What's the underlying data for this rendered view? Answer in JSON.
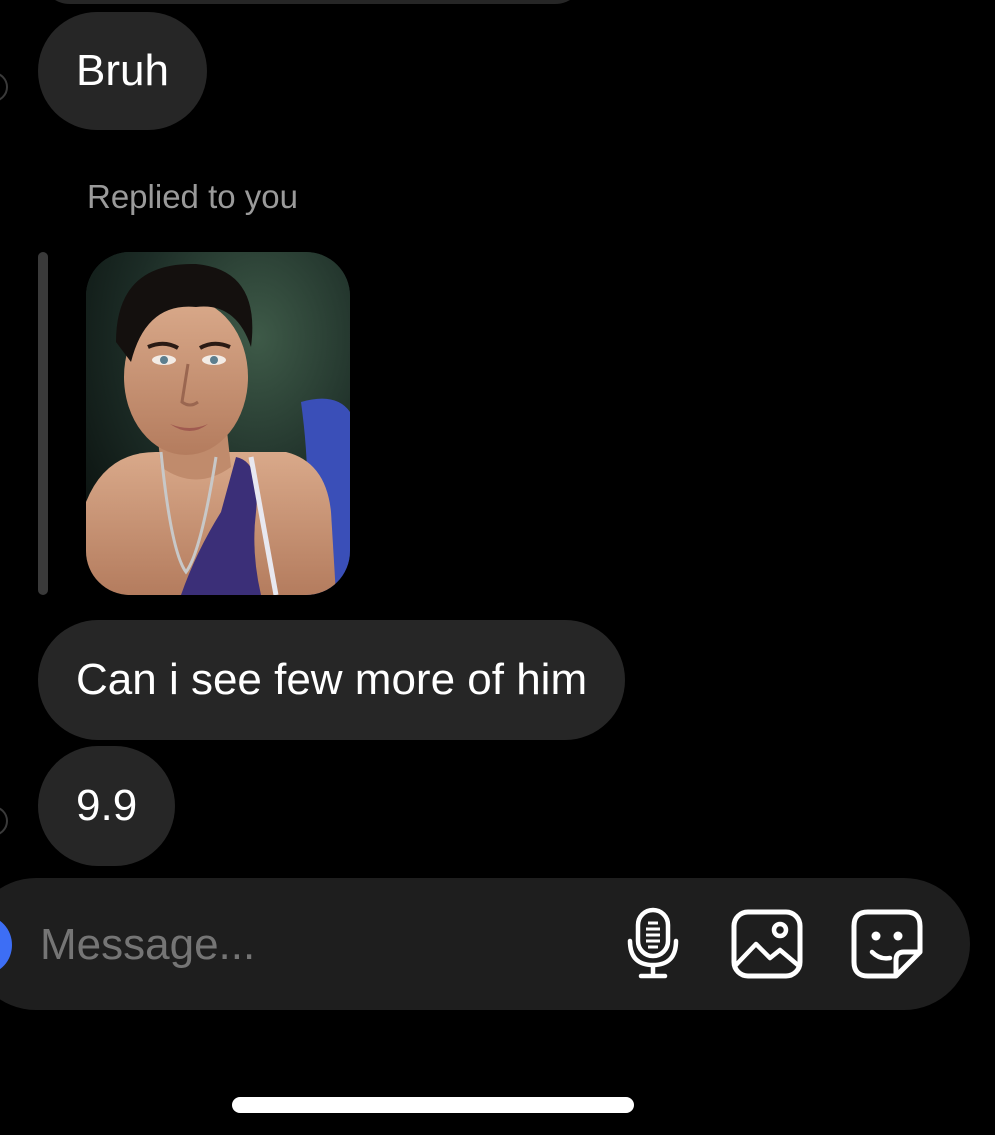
{
  "messages": {
    "bruh": "Bruh",
    "reply_label": "Replied to you",
    "ask": "Can i see few more of him",
    "score": "9.9"
  },
  "composer": {
    "placeholder": "Message..."
  },
  "icons": {
    "mic": "microphone-icon",
    "gallery": "image-icon",
    "sticker": "sticker-icon"
  },
  "colors": {
    "background": "#000000",
    "bubble": "#262626",
    "composer": "#1e1e1e",
    "accent": "#3d6ef5",
    "muted_text": "#9a9a9a"
  }
}
